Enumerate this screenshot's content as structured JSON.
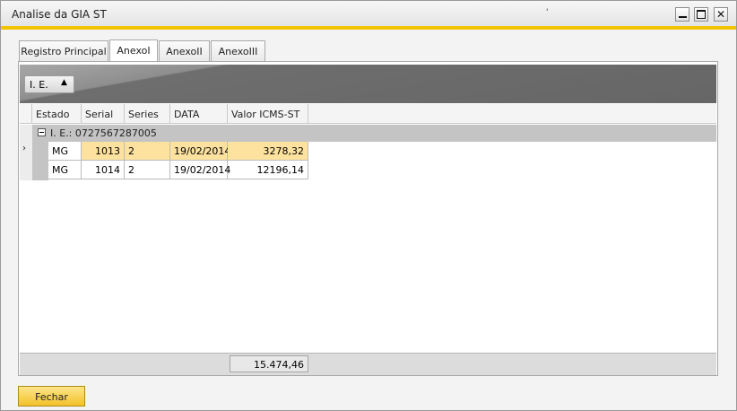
{
  "window": {
    "title": "Analise da GIA ST",
    "title_mark": "'"
  },
  "tabs": [
    {
      "label": "Registro Principal"
    },
    {
      "label": "AnexoI"
    },
    {
      "label": "AnexoII"
    },
    {
      "label": "AnexoIII"
    }
  ],
  "active_tab": "AnexoI",
  "grid": {
    "group_by_chip": {
      "label": "I. E.",
      "sort_indicator": "▲"
    },
    "columns": [
      "Estado",
      "Serial",
      "Series",
      "DATA",
      "Valor ICMS-ST"
    ],
    "group_label": "I. E.: 0727567287005",
    "rows": [
      {
        "estado": "MG",
        "serial": "1013",
        "series": "2",
        "data": "19/02/2014",
        "valor": "3278,32"
      },
      {
        "estado": "MG",
        "serial": "1014",
        "series": "2",
        "data": "19/02/2014",
        "valor": "12196,14"
      }
    ],
    "selected_row_marker": "›",
    "total": "15.474,46"
  },
  "buttons": {
    "close_label": "Fechar"
  },
  "colors": {
    "accent": "#f2c300",
    "selection": "#fde29f"
  }
}
